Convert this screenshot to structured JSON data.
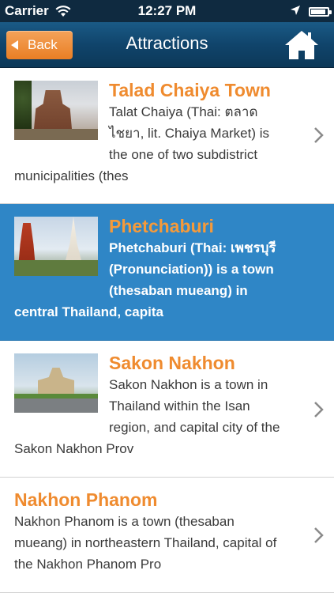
{
  "status_bar": {
    "carrier": "Carrier",
    "time": "12:27 PM",
    "battery_level": 0.9
  },
  "nav": {
    "back_label": "Back",
    "title": "Attractions",
    "home_icon": "home-icon"
  },
  "colors": {
    "nav_bar": "#10446b",
    "accent_orange": "#ef8b2f",
    "selected_row": "#2f86c6"
  },
  "attractions": [
    {
      "title": "Talad Chaiya Town",
      "description": "Talat Chaiya (Thai: ตลาดไชยา, lit. Chaiya Market) is the one of two subdistrict municipalities (thes",
      "has_image": true,
      "selected": false
    },
    {
      "title": "Phetchaburi",
      "description": "Phetchaburi (Thai: เพชรบุรี (Pronunciation)) is a town (thesaban mueang) in central Thailand, capita",
      "has_image": true,
      "selected": true
    },
    {
      "title": "Sakon Nakhon",
      "description": "Sakon Nakhon is a town in Thailand within the Isan region, and capital city of the Sakon Nakhon Prov",
      "has_image": true,
      "selected": false
    },
    {
      "title": "Nakhon Phanom",
      "description": "Nakhon Phanom is a town (thesaban mueang) in northeastern Thailand, capital of the Nakhon Phanom Pro",
      "has_image": false,
      "selected": false
    }
  ]
}
